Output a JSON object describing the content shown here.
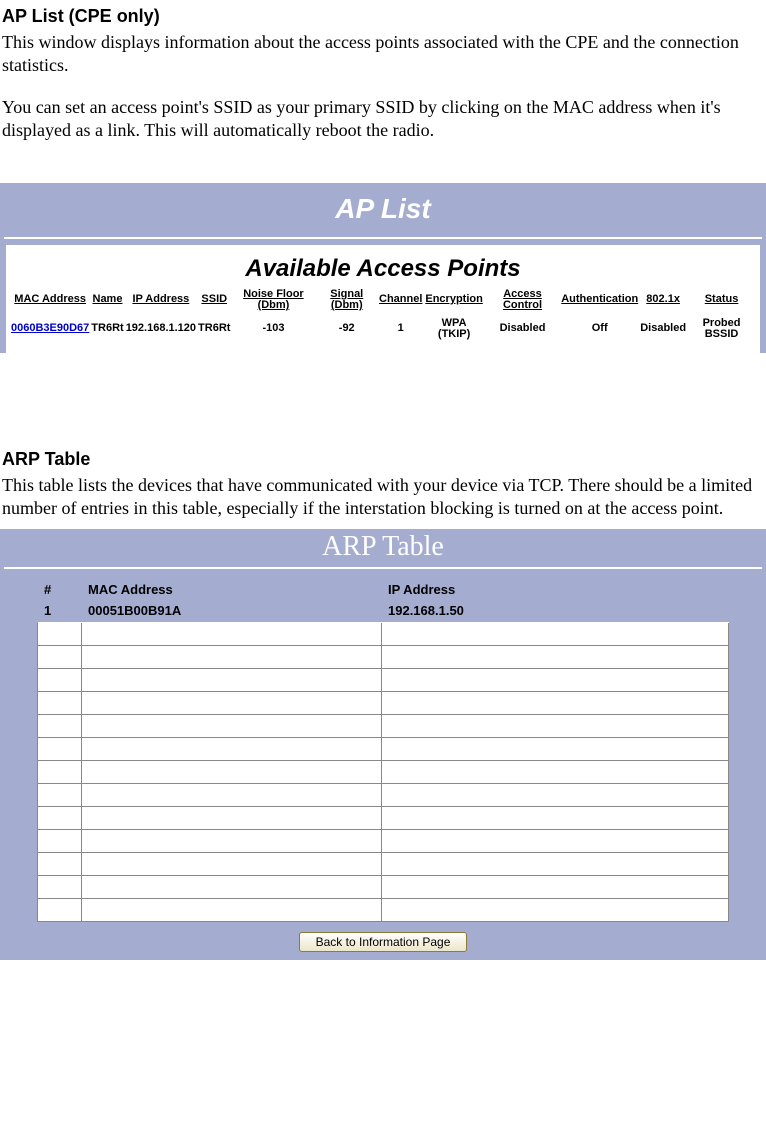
{
  "section1": {
    "heading": "AP List (CPE only)",
    "para1": "This window displays information about the access points associated with the CPE and the connection statistics.",
    "para2": "You can set an access point's SSID as your primary SSID by clicking on the MAC address when it's displayed as a link. This will automatically reboot the radio."
  },
  "ap_list": {
    "banner": "AP List",
    "avail_title": "Available Access Points",
    "headers": {
      "mac": "MAC Address",
      "name": "Name",
      "ip": "IP Address",
      "ssid": "SSID",
      "noise": "Noise Floor (Dbm)",
      "signal": "Signal (Dbm)",
      "channel": "Channel",
      "encryption": "Encryption",
      "access": "Access Control",
      "auth": "Authentication",
      "dot1x": "802.1x",
      "status": "Status"
    },
    "row": {
      "mac": "0060B3E90D67",
      "name": "TR6Rt",
      "ip": "192.168.1.120",
      "ssid": "TR6Rt",
      "noise": "-103",
      "signal": "-92",
      "channel": "1",
      "encryption": "WPA (TKIP)",
      "access": "Disabled",
      "auth": "Off",
      "dot1x": "Disabled",
      "status": "Probed BSSID"
    }
  },
  "section2": {
    "heading": "ARP Table",
    "para": "This table lists the devices that have communicated with your device via TCP. There should be a limited number of entries in this table, especially if the interstation blocking is turned on at the access point."
  },
  "arp": {
    "banner": "ARP Table",
    "headers": {
      "num": "#",
      "mac": "MAC Address",
      "ip": "IP Address"
    },
    "row": {
      "num": "1",
      "mac": "00051B00B91A",
      "ip": "192.168.1.50"
    },
    "back_btn": "Back to Information Page"
  }
}
